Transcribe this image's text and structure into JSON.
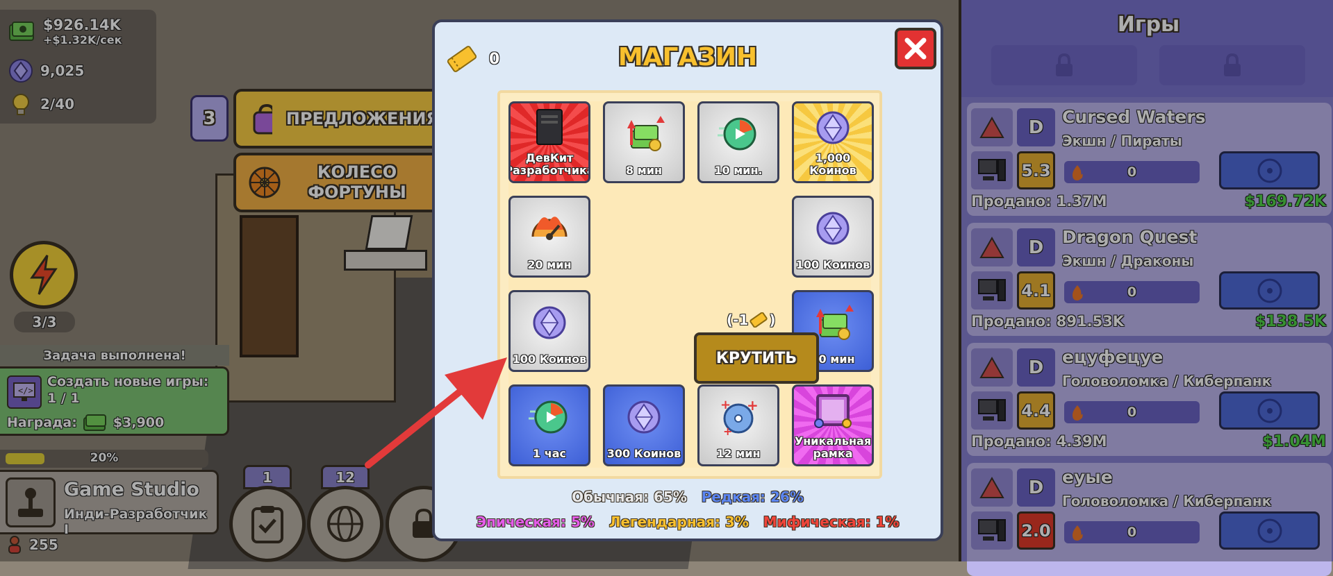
{
  "hud": {
    "money": "$926.14K",
    "income": "+$1.32K/сек",
    "gems": "9,025",
    "ideas": "2/40",
    "energy": "3/3"
  },
  "offers": {
    "badge": "3",
    "offers_label": "ПРЕДЛОЖЕНИЯ",
    "wheel_label_line1": "КОЛЕСО",
    "wheel_label_line2": "ФОРТУНЫ"
  },
  "task": {
    "header": "Задача выполнена!",
    "title": "Создать новые игры:",
    "progress": "1 / 1",
    "reward_label": "Награда:",
    "reward_value": "$3,900"
  },
  "studio": {
    "xp_percent_label": "20%",
    "xp_fraction": 0.2,
    "name": "Game Studio",
    "rank": "Инди-Разработчик I",
    "staff_count": "255"
  },
  "bottom_tabs": [
    {
      "badge": "1",
      "icon": "clipboard-check-icon"
    },
    {
      "badge": "12",
      "icon": "globe-icon"
    },
    {
      "badge": "",
      "icon": "lock-icon"
    }
  ],
  "games_panel": {
    "title": "Игры",
    "games": [
      {
        "name": "Cursed Waters",
        "genre": "Экшн / Пираты",
        "grade": "D",
        "score": "5.3",
        "score_color": "#e8b033",
        "hype": "0",
        "sold": "Продано: 1.37M",
        "profit": "$169.72K"
      },
      {
        "name": "Dragon Quest",
        "genre": "Экшн / Драконы",
        "grade": "D",
        "score": "4.1",
        "score_color": "#e8b033",
        "hype": "0",
        "sold": "Продано: 891.53K",
        "profit": "$138.5K"
      },
      {
        "name": "ецуфецуе",
        "genre": "Головоломка / Киберпанк",
        "grade": "D",
        "score": "4.4",
        "score_color": "#e8b033",
        "hype": "0",
        "sold": "Продано: 4.39M",
        "profit": "$1.04M"
      },
      {
        "name": "еуые",
        "genre": "Головоломка / Киберпанк",
        "grade": "D",
        "score": "2.0",
        "score_color": "#e23a2a",
        "hype": "0",
        "sold": "",
        "profit": ""
      }
    ]
  },
  "shop": {
    "title": "МАГАЗИН",
    "tickets": "0",
    "spin_cost": "(-1",
    "spin_cost_close": ")",
    "spin_label": "КРУТИТЬ",
    "cells": [
      {
        "label": "ДевКит Разработчика",
        "style": "red",
        "icon": "devkit-icon"
      },
      {
        "label": "8 мин",
        "style": "gray",
        "icon": "cash-boost-icon"
      },
      {
        "label": "10 мин.",
        "style": "gray",
        "icon": "speed-clock-icon"
      },
      {
        "label": "1,000 Коинов",
        "style": "gold",
        "icon": "gem-coin-icon"
      },
      {
        "label": "20 мин",
        "style": "gray",
        "icon": "hype-meter-icon"
      },
      {
        "label": "100 Коинов",
        "style": "gray",
        "icon": "gem-coin-icon"
      },
      {
        "label": "100 Коинов",
        "style": "gray",
        "icon": "gem-coin-icon"
      },
      {
        "label": "30 мин",
        "style": "blue",
        "icon": "cash-boost-icon"
      },
      {
        "label": "1 час",
        "style": "blue",
        "icon": "speed-clock-icon"
      },
      {
        "label": "300 Коинов",
        "style": "blue",
        "icon": "gem-coin-icon"
      },
      {
        "label": "12 мин",
        "style": "gray",
        "icon": "disc-plus-icon"
      },
      {
        "label": "Уникальная рамка",
        "style": "pink",
        "icon": "frame-icon"
      }
    ],
    "odds": {
      "common": "Обычная: 65%",
      "rare": "Редкая: 26%",
      "epic": "Эпическая: 5%",
      "legendary": "Легендарная: 3%",
      "mythic": "Мифическая: 1%"
    },
    "colors": {
      "common": "#e9e9e9",
      "rare": "#5c86f2",
      "epic": "#e35ce8",
      "legendary": "#f8c02e",
      "mythic": "#f0453a"
    }
  }
}
